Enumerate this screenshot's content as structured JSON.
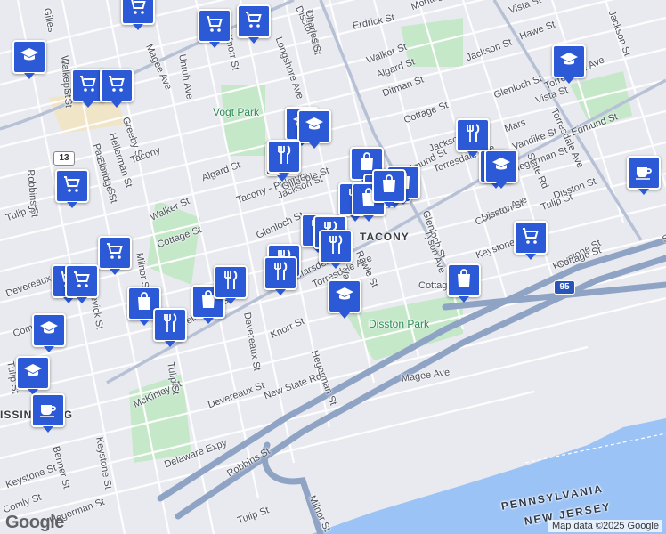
{
  "map": {
    "neighborhoods": [
      {
        "text": "TACONY"
      },
      {
        "text": "ISSINOMING"
      }
    ],
    "parks": [
      {
        "text": "Vogt Park"
      },
      {
        "text": "Disston Park"
      }
    ],
    "water_labels": [
      {
        "text": "PENNSYLVANIA"
      },
      {
        "text": "NEW JERSEY"
      }
    ],
    "streets": [
      "Tyson Ave",
      "Erdrick St",
      "Montague St",
      "Disston St",
      "Walker St",
      "Algard St",
      "Longshore Ave",
      "Knorr St",
      "Unruh Ave",
      "Magee Ave",
      "Gillespie St",
      "Greeby St",
      "Hellerman St",
      "Passmore St",
      "Elbridge St",
      "Robbins St",
      "Walker St",
      "Algard St",
      "Cottage St",
      "Jackson St",
      "Glenloch St",
      "Glenloch St",
      "Ditman St",
      "Cottage St",
      "Jackson St",
      "Marsden St",
      "Vandike St",
      "Hegerman St",
      "Edmund St",
      "Edmund St",
      "Torresdale Ave",
      "Torresdale Ave",
      "Cottman Ave",
      "Tulip St",
      "Keystone St",
      "Keystone St",
      "State Rd",
      "Milnor St",
      "Levick St",
      "McKinley St",
      "Devereaux St",
      "Hellerman St",
      "Torresdale Ave",
      "Vandike St",
      "Rawle St",
      "Knorr St",
      "Hegerman St",
      "Magee Ave",
      "New State Rd",
      "Keystone St",
      "Devereaux St",
      "Tulip St",
      "Robbins St",
      "Delaware Expy",
      "Keystone St",
      "Benner St",
      "Comly St",
      "Hegerman St",
      "Tulip St",
      "Milnor St",
      "Tacony - Palmyra",
      "Gillespie St",
      "Jackson St",
      "Vista St",
      "Torresdale Ave",
      "Mars",
      "Glenloch St",
      "Tyson Ave",
      "Disston St",
      "Tulip St",
      "Comly St",
      "Devereaux St",
      "Cottage St",
      "Tacony",
      "Walker St",
      "Gilles",
      "Hawe St",
      "Jackson St",
      "Vista St",
      "Cottage St",
      "State Rd",
      "Disston St",
      "Tulip St",
      "Charles St"
    ],
    "routes": [
      {
        "text": "13"
      },
      {
        "text": "95"
      }
    ],
    "markers": [
      {
        "icon": "shopping-cart-icon"
      },
      {
        "icon": "shopping-cart-icon"
      },
      {
        "icon": "shopping-cart-icon"
      },
      {
        "icon": "education-cap-icon"
      },
      {
        "icon": "shopping-cart-icon"
      },
      {
        "icon": "shopping-cart-icon"
      },
      {
        "icon": "education-cap-icon"
      },
      {
        "icon": "education-cap-icon"
      },
      {
        "icon": "education-cap-icon"
      },
      {
        "icon": "restaurant-icon"
      },
      {
        "icon": "restaurant-icon"
      },
      {
        "icon": "education-cap-icon"
      },
      {
        "icon": "shopping-bag-icon"
      },
      {
        "icon": "shopping-bag-icon"
      },
      {
        "icon": "shopping-bag-icon"
      },
      {
        "icon": "shopping-bag-icon"
      },
      {
        "icon": "restaurant-icon"
      },
      {
        "icon": "restaurant-icon"
      },
      {
        "icon": "restaurant-icon"
      },
      {
        "icon": "restaurant-icon"
      },
      {
        "icon": "restaurant-icon"
      },
      {
        "icon": "restaurant-icon"
      },
      {
        "icon": "shopping-bag-icon"
      },
      {
        "icon": "shopping-bag-icon"
      },
      {
        "icon": "shopping-cart-icon"
      },
      {
        "icon": "shopping-cart-icon"
      },
      {
        "icon": "shopping-bag-icon"
      },
      {
        "icon": "shopping-bag-icon"
      },
      {
        "icon": "restaurant-icon"
      },
      {
        "icon": "shopping-cart-icon"
      },
      {
        "icon": "shopping-cart-icon"
      },
      {
        "icon": "education-cap-icon"
      },
      {
        "icon": "education-cap-icon"
      },
      {
        "icon": "coffee-cup-icon"
      },
      {
        "icon": "education-cap-icon"
      },
      {
        "icon": "restaurant-icon"
      },
      {
        "icon": "shopping-cart-icon"
      },
      {
        "icon": "shopping-bag-icon"
      },
      {
        "icon": "education-cap-icon"
      },
      {
        "icon": "coffee-cup-icon"
      },
      {
        "icon": "restaurant-icon"
      }
    ],
    "colors": {
      "marker": "#2c59d6",
      "park": "#c5e8c9",
      "water": "#9cc3f5",
      "highway": "#8fa3c5",
      "land": "#e9eaef"
    }
  },
  "footer": {
    "logo": "Google",
    "attribution": "Map data ©2025 Google"
  }
}
